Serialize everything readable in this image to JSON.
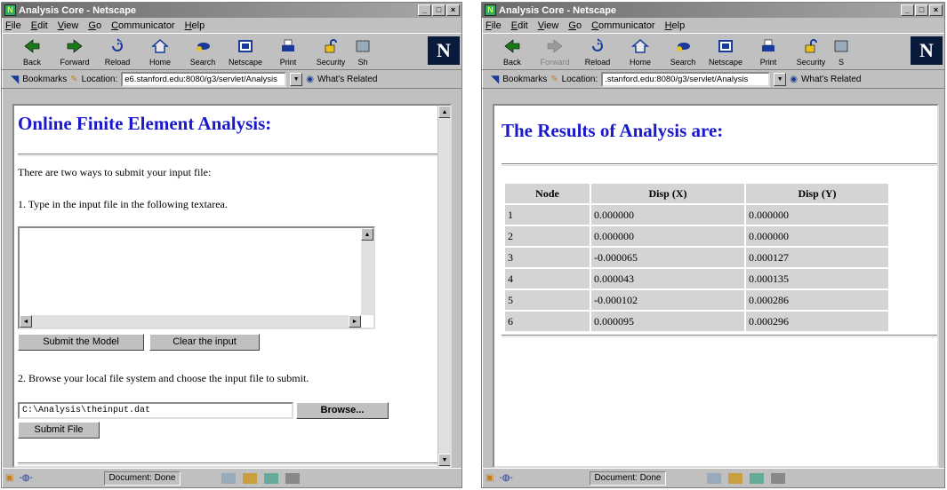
{
  "menu": [
    "File",
    "Edit",
    "View",
    "Go",
    "Communicator",
    "Help"
  ],
  "toolbar": [
    {
      "label": "Back",
      "icon": "back-arrow-icon",
      "enabled": true
    },
    {
      "label": "Forward",
      "icon": "forward-arrow-icon",
      "enabled": true
    },
    {
      "label": "Reload",
      "icon": "reload-icon",
      "enabled": true
    },
    {
      "label": "Home",
      "icon": "home-icon",
      "enabled": true
    },
    {
      "label": "Search",
      "icon": "search-icon",
      "enabled": true
    },
    {
      "label": "Netscape",
      "icon": "netscape-icon",
      "enabled": true
    },
    {
      "label": "Print",
      "icon": "printer-icon",
      "enabled": true
    },
    {
      "label": "Security",
      "icon": "lock-icon",
      "enabled": true
    }
  ],
  "location_label": "Location:",
  "bookmarks_label": "Bookmarks",
  "whats_related": "What's Related",
  "window1": {
    "title": "Analysis Core - Netscape",
    "toolbar_extra": "Sh",
    "url": "e6.stanford.edu:8080/g3/servlet/Analysis",
    "heading": "Online Finite Element Analysis:",
    "intro": "There are two ways to submit your input file:",
    "step1": "1. Type in the input file in the following textarea.",
    "submit_model": "Submit the Model",
    "clear_input": "Clear the input",
    "step2": "2. Browse your local file system and choose the input file to submit.",
    "file_path": "C:\\Analysis\\theinput.dat",
    "browse": "Browse...",
    "submit_file": "Submit File",
    "status": "Document: Done"
  },
  "window2": {
    "title": "Analysis Core - Netscape",
    "toolbar_extra": "S",
    "url": ".stanford.edu:8080/g3/servlet/Analysis",
    "heading": "The Results of Analysis are:",
    "table": {
      "headers": [
        "Node",
        "Disp (X)",
        "Disp (Y)"
      ],
      "rows": [
        [
          "1",
          "0.000000",
          "0.000000"
        ],
        [
          "2",
          "0.000000",
          "0.000000"
        ],
        [
          "3",
          "-0.000065",
          "0.000127"
        ],
        [
          "4",
          "0.000043",
          "0.000135"
        ],
        [
          "5",
          "-0.000102",
          "0.000286"
        ],
        [
          "6",
          "0.000095",
          "0.000296"
        ]
      ]
    },
    "status": "Document: Done"
  }
}
